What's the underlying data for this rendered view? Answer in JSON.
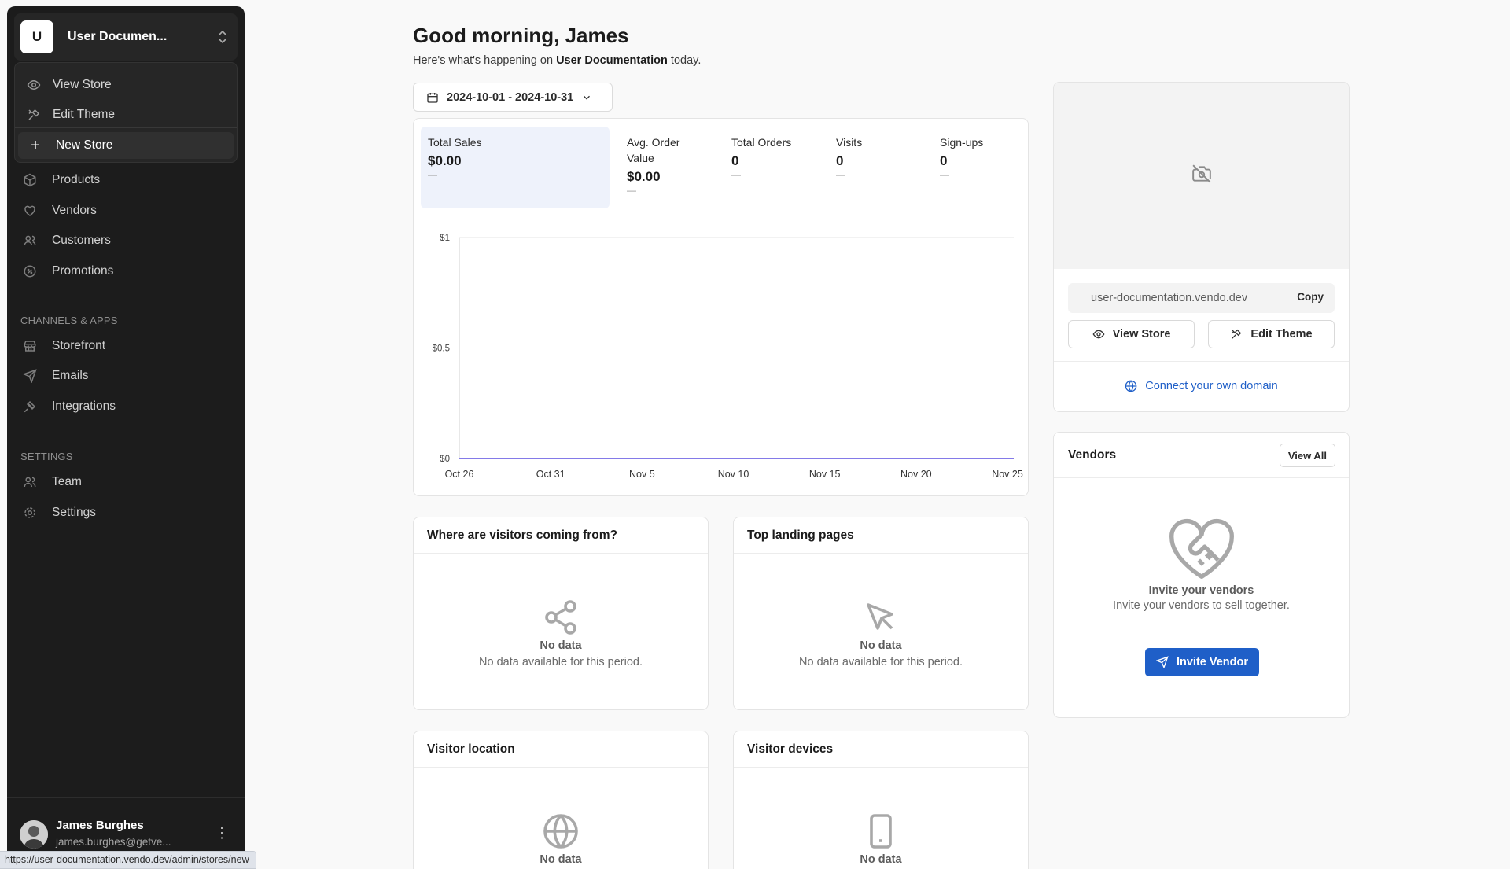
{
  "sidebar": {
    "store": {
      "initial": "U",
      "name": "User Documen..."
    },
    "dropdown": {
      "view_store": "View Store",
      "edit_theme": "Edit Theme",
      "new_store": "New Store"
    },
    "nav": [
      {
        "label": "Products",
        "icon": "box-icon"
      },
      {
        "label": "Vendors",
        "icon": "heart-handshake-icon"
      },
      {
        "label": "Customers",
        "icon": "users-icon"
      },
      {
        "label": "Promotions",
        "icon": "percent-badge-icon"
      }
    ],
    "channels_title": "CHANNELS & APPS",
    "channels": [
      {
        "label": "Storefront",
        "icon": "store-icon"
      },
      {
        "label": "Emails",
        "icon": "send-icon"
      },
      {
        "label": "Integrations",
        "icon": "plug-icon"
      }
    ],
    "settings_title": "SETTINGS",
    "settings": [
      {
        "label": "Team",
        "icon": "users-icon"
      },
      {
        "label": "Settings",
        "icon": "gear-icon"
      }
    ],
    "user": {
      "name": "James Burghes",
      "email": "james.burghes@getve..."
    }
  },
  "status_url": "https://user-documentation.vendo.dev/admin/stores/new",
  "header": {
    "greeting": "Good morning, James",
    "sub_prefix": "Here's what's happening on ",
    "sub_store": "User Documentation",
    "sub_suffix": " today."
  },
  "date_range": "2024-10-01 - 2024-10-31",
  "stats": [
    {
      "label": "Total Sales",
      "value": "$0.00",
      "change": "—"
    },
    {
      "label": "Avg. Order Value",
      "value": "$0.00",
      "change": "—"
    },
    {
      "label": "Total Orders",
      "value": "0",
      "change": "—"
    },
    {
      "label": "Visits",
      "value": "0",
      "change": "—"
    },
    {
      "label": "Sign-ups",
      "value": "0",
      "change": "—"
    }
  ],
  "chart_data": {
    "type": "line",
    "title": "",
    "xlabel": "",
    "ylabel": "",
    "x": [
      "Oct 26",
      "Oct 31",
      "Nov 5",
      "Nov 10",
      "Nov 15",
      "Nov 20",
      "Nov 25"
    ],
    "series": [
      {
        "values": [
          0,
          0,
          0,
          0,
          0,
          0,
          0
        ],
        "color": "#5b4fe0"
      }
    ],
    "y_ticks": [
      "$0",
      "$0.5",
      "$1"
    ],
    "ylim": [
      0,
      1
    ],
    "grid": true
  },
  "visitors_from": {
    "title": "Where are visitors coming from?",
    "empty_title": "No data",
    "empty_desc": "No data available for this period."
  },
  "landing_pages": {
    "title": "Top landing pages",
    "empty_title": "No data",
    "empty_desc": "No data available for this period."
  },
  "visitor_location": {
    "title": "Visitor location",
    "empty_title": "No data"
  },
  "visitor_devices": {
    "title": "Visitor devices",
    "empty_title": "No data"
  },
  "store_card": {
    "url": "user-documentation.vendo.dev",
    "copy": "Copy",
    "view_store": "View Store",
    "edit_theme": "Edit Theme",
    "connect_domain": "Connect your own domain"
  },
  "vendors_card": {
    "title": "Vendors",
    "view_all": "View All",
    "empty_title": "Invite your vendors",
    "empty_desc": "Invite your vendors to sell together.",
    "invite_button": "Invite Vendor"
  },
  "colors": {
    "accent": "#1f5fc8",
    "sidebar": "#1c1c1c",
    "line": "#5b4fe0"
  }
}
